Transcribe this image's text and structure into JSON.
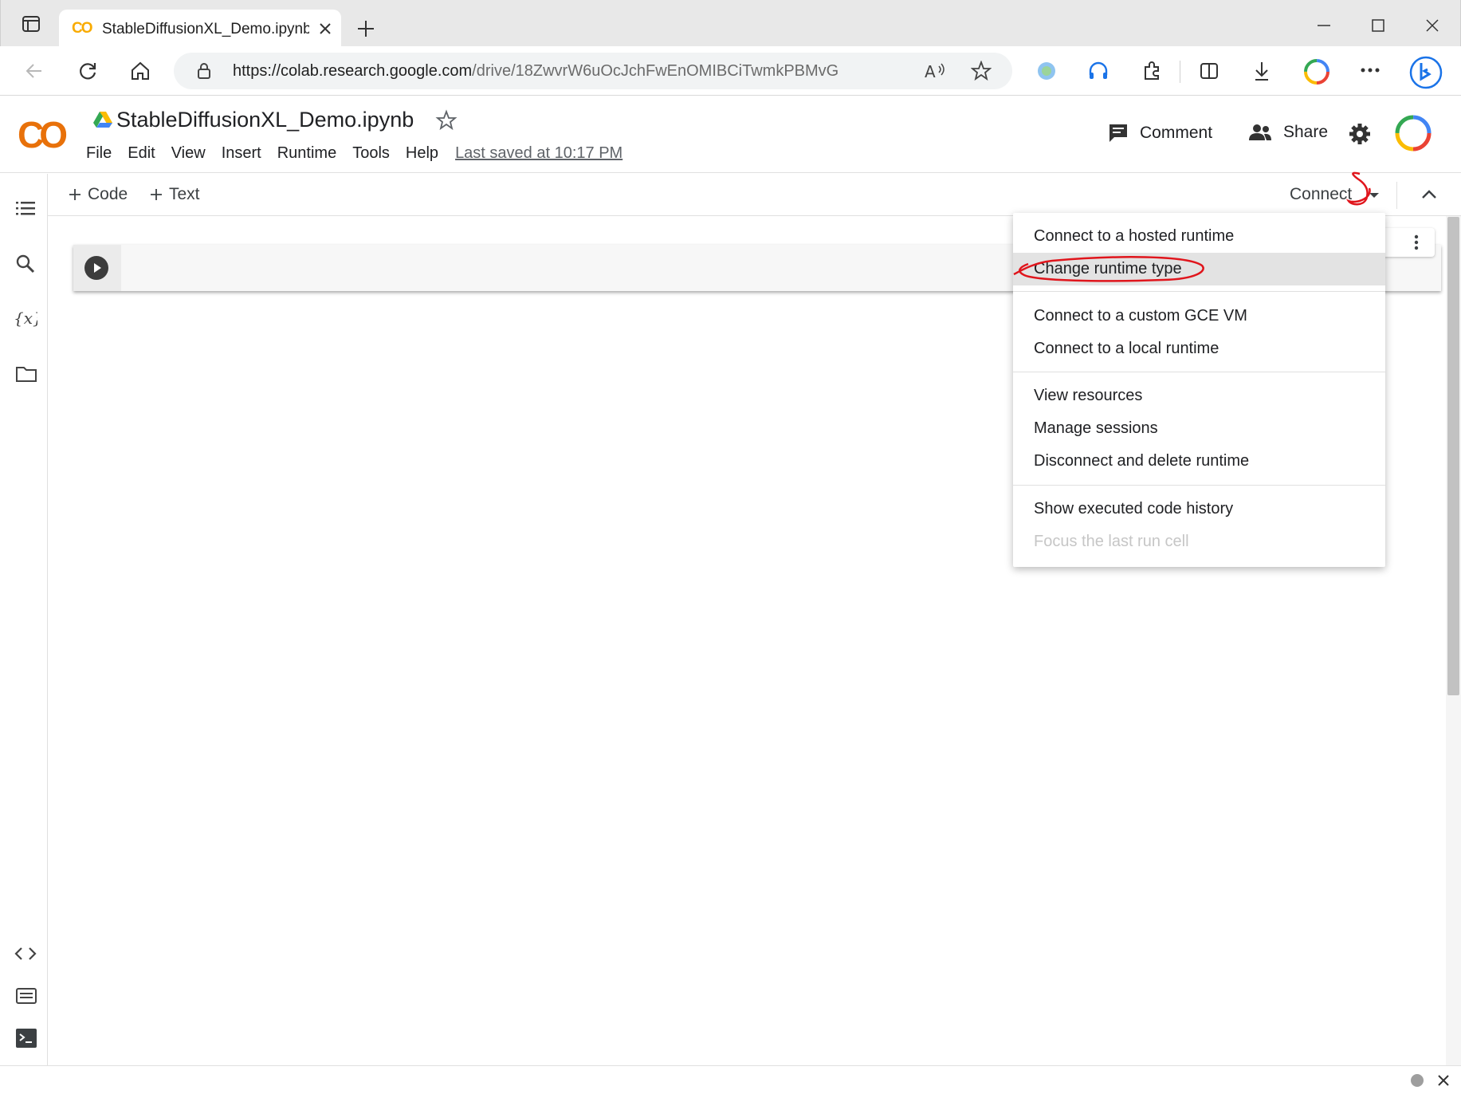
{
  "browser": {
    "tab_title": "StableDiffusionXL_Demo.ipynb -",
    "tab_favicon": "CO",
    "url_host": "https://colab.research.google.com",
    "url_path": "/drive/18ZwvrW6uOcJchFwEnOMIBCiTwmkPBMvG"
  },
  "colab": {
    "logo": "CO",
    "notebook_title": "StableDiffusionXL_Demo.ipynb",
    "menu": [
      "File",
      "Edit",
      "View",
      "Insert",
      "Runtime",
      "Tools",
      "Help"
    ],
    "last_saved": "Last saved at 10:17 PM",
    "comment_label": "Comment",
    "share_label": "Share"
  },
  "toolbar": {
    "add_code": "Code",
    "add_text": "Text",
    "connect": "Connect"
  },
  "dropdown": {
    "items": [
      "Connect to a hosted runtime",
      "Change runtime type",
      "Connect to a custom GCE VM",
      "Connect to a local runtime",
      "View resources",
      "Manage sessions",
      "Disconnect and delete runtime",
      "Show executed code history",
      "Focus the last run cell"
    ],
    "highlighted": "Change runtime type",
    "disabled": "Focus the last run cell"
  },
  "colors": {
    "colab_orange": "#f9ab00",
    "annotation_red": "#e0151c"
  }
}
